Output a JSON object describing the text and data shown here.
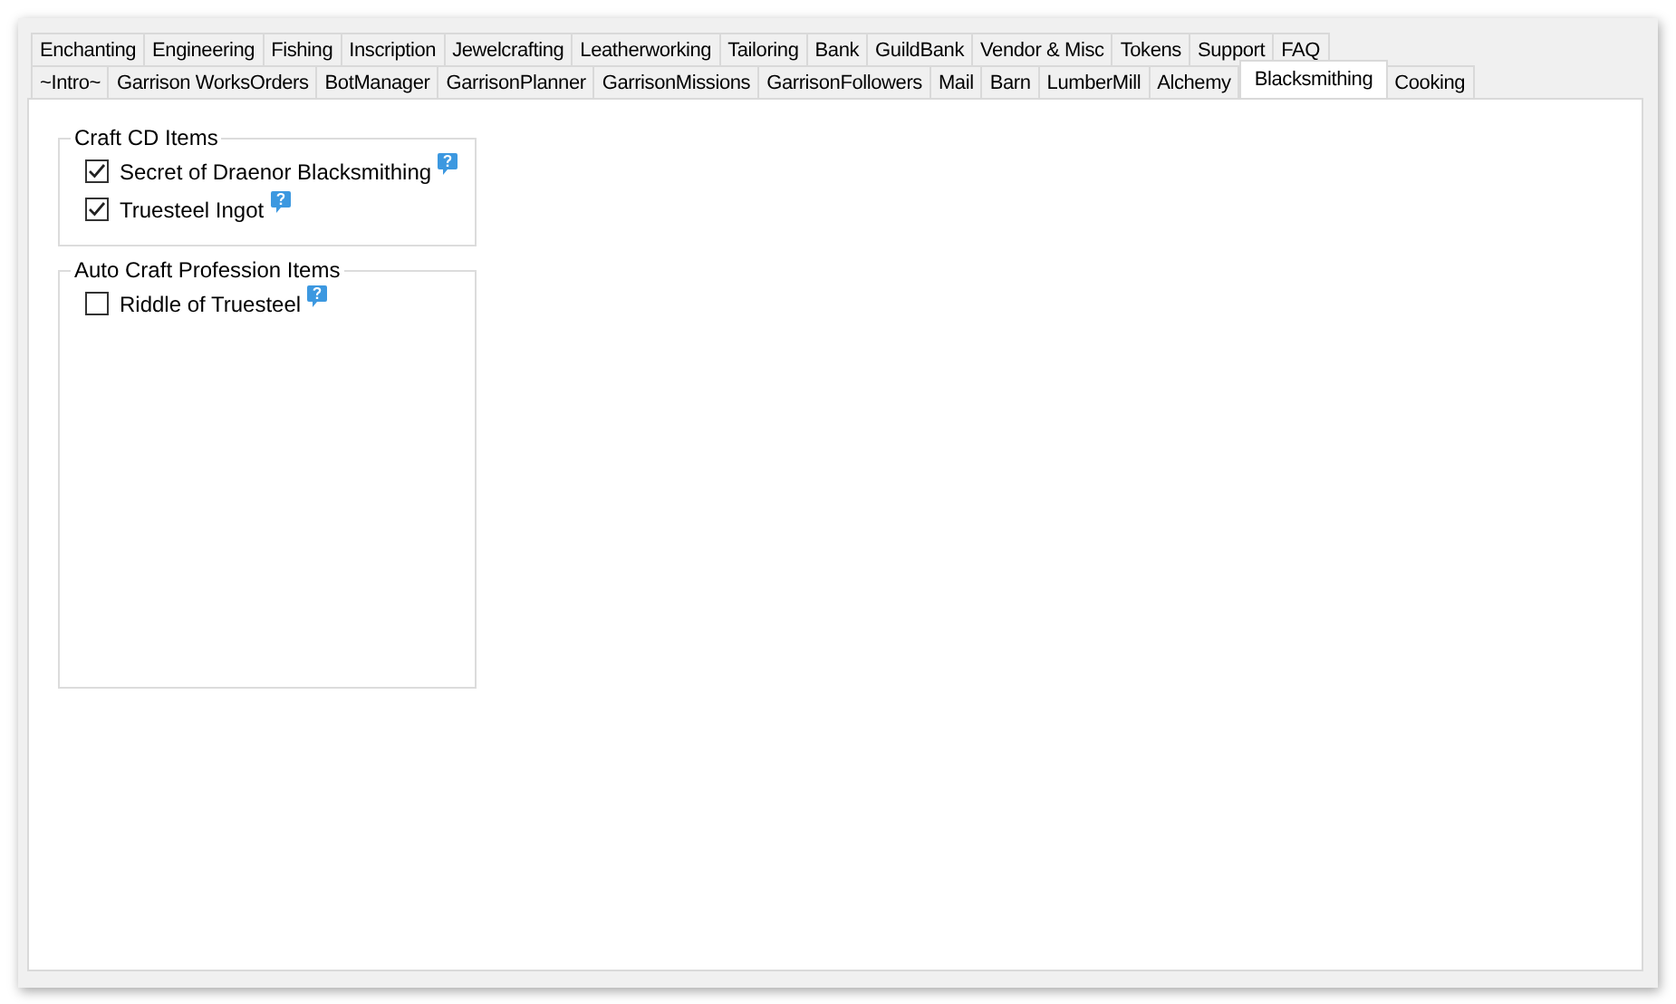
{
  "tab_rows": [
    {
      "tabs": [
        {
          "label": "Enchanting",
          "selected": false
        },
        {
          "label": "Engineering",
          "selected": false
        },
        {
          "label": "Fishing",
          "selected": false
        },
        {
          "label": "Inscription",
          "selected": false
        },
        {
          "label": "Jewelcrafting",
          "selected": false
        },
        {
          "label": "Leatherworking",
          "selected": false
        },
        {
          "label": "Tailoring",
          "selected": false
        },
        {
          "label": "Bank",
          "selected": false
        },
        {
          "label": "GuildBank",
          "selected": false
        },
        {
          "label": "Vendor & Misc",
          "selected": false
        },
        {
          "label": "Tokens",
          "selected": false
        },
        {
          "label": "Support",
          "selected": false
        },
        {
          "label": "FAQ",
          "selected": false
        }
      ]
    },
    {
      "tabs": [
        {
          "label": "~Intro~",
          "selected": false
        },
        {
          "label": "Garrison WorksOrders",
          "selected": false
        },
        {
          "label": "BotManager",
          "selected": false
        },
        {
          "label": "GarrisonPlanner",
          "selected": false
        },
        {
          "label": "GarrisonMissions",
          "selected": false
        },
        {
          "label": "GarrisonFollowers",
          "selected": false
        },
        {
          "label": "Mail",
          "selected": false
        },
        {
          "label": "Barn",
          "selected": false
        },
        {
          "label": "LumberMill",
          "selected": false
        },
        {
          "label": "Alchemy",
          "selected": false
        },
        {
          "label": "Blacksmithing",
          "selected": true
        },
        {
          "label": "Cooking",
          "selected": false
        }
      ]
    }
  ],
  "groups": [
    {
      "title": "Craft CD Items",
      "items": [
        {
          "label": "Secret of Draenor Blacksmithing",
          "checked": true
        },
        {
          "label": "Truesteel Ingot",
          "checked": true
        }
      ]
    },
    {
      "title": "Auto Craft Profession Items",
      "items": [
        {
          "label": "Riddle of Truesteel",
          "checked": false
        }
      ]
    }
  ]
}
